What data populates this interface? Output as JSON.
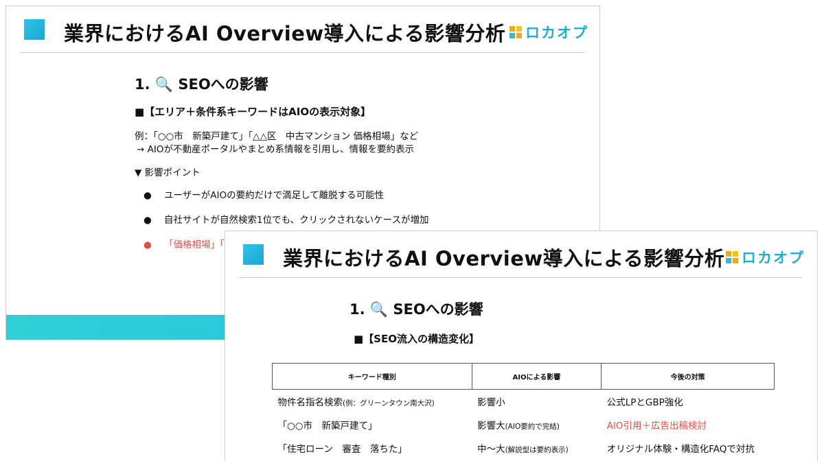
{
  "back_slide": {
    "title": "業界におけるAI Overview導入による影響分析",
    "logo": "ロカオプ",
    "section": "1. 🔍 SEOへの影響",
    "subheading": "■【エリア＋条件系キーワードはAIOの表示対象】",
    "example_line1": "例：「○○市　新築戸建て」「△△区　中古マンション 価格相場」など",
    "example_line2": "→ AIOが不動産ポータルやまとめ系情報を引用し、情報を要約表示",
    "points_heading": "▼ 影響ポイント",
    "bullets": [
      "ユーザーがAIOの要約だけで満足して離脱する可能性",
      "自社サイトが自然検索1位でも、クリックされないケースが増加",
      "「価格相場」「エリ"
    ],
    "accent_color": "#e0504a"
  },
  "front_slide": {
    "title": "業界におけるAI Overview導入による影響分析",
    "logo": "ロカオプ",
    "section": "1. 🔍 SEOへの影響",
    "subheading": "■【SEO流入の構造変化】",
    "table": {
      "headers": [
        "キーワード種別",
        "AIOによる影響",
        "今後の対策"
      ],
      "rows": [
        {
          "keyword": "物件名指名検索",
          "keyword_note": "(例：グリーンタウン南大沢)",
          "impact": "影響小",
          "impact_note": "",
          "action": "公式LPとGBP強化",
          "action_highlight": false
        },
        {
          "keyword": "「○○市　新築戸建て」",
          "keyword_note": "",
          "impact": "影響大",
          "impact_note": "(AIO要約で完結)",
          "action": "AIO引用＋広告出稿検討",
          "action_highlight": true
        },
        {
          "keyword": "「住宅ローン　審査　落ちた」",
          "keyword_note": "",
          "impact": "中〜大",
          "impact_note": "(解説型は要約表示)",
          "action": "オリジナル体験・構造化FAQで対抗",
          "action_highlight": false
        }
      ]
    }
  }
}
